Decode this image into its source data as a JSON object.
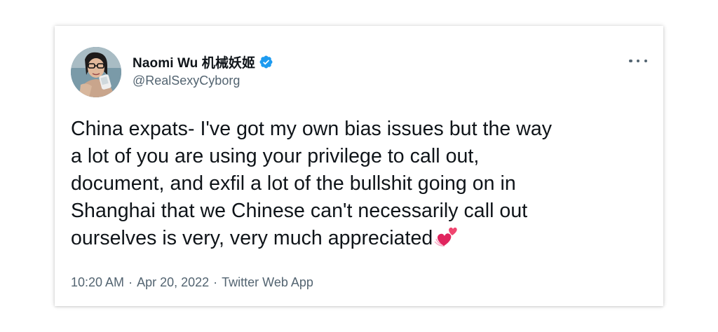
{
  "tweet": {
    "display_name": "Naomi Wu 机械妖姬",
    "handle": "@RealSexyCyborg",
    "text_lines": [
      "China expats- I've got my own bias issues but the way",
      "a lot of you are using your privilege to call out,",
      "document, and exfil a lot of the bullshit going on in",
      "Shanghai that we Chinese can't necessarily call out",
      "ourselves is very, very much appreciated"
    ],
    "emoji": "two-hearts-icon",
    "time": "10:20 AM",
    "separator": "·",
    "date": "Apr 20, 2022",
    "source": "Twitter Web App"
  },
  "icons": {
    "verified": "verified-badge-icon",
    "more": "more-options-icon"
  },
  "colors": {
    "text": "#0f1419",
    "secondary": "#536471",
    "verified": "#1d9bf0",
    "heart": "#e0245e"
  }
}
